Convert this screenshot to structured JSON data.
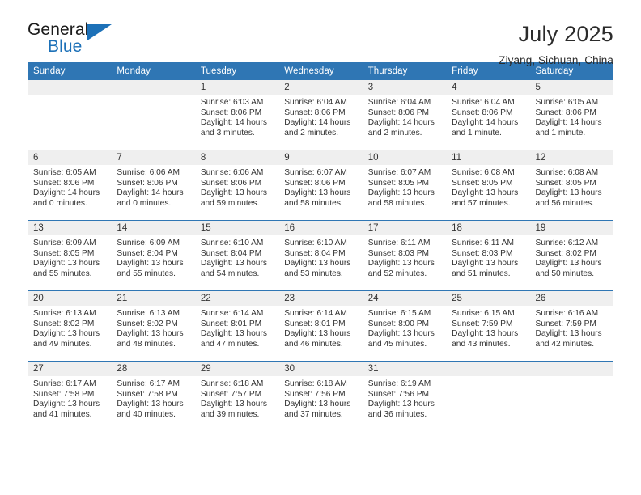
{
  "brand": {
    "name_top": "General",
    "name_bottom": "Blue",
    "accent_color": "#1d71b8"
  },
  "header": {
    "title": "July 2025",
    "location": "Ziyang, Sichuan, China"
  },
  "theme": {
    "header_blue": "#2f76b4",
    "daynum_gray": "#efefef",
    "text": "#333333"
  },
  "weekday_headers": [
    "Sunday",
    "Monday",
    "Tuesday",
    "Wednesday",
    "Thursday",
    "Friday",
    "Saturday"
  ],
  "labels": {
    "sunrise_prefix": "Sunrise:",
    "sunset_prefix": "Sunset:",
    "daylight_prefix": "Daylight:"
  },
  "weeks": [
    [
      {
        "day": "",
        "sunrise": "",
        "sunset": "",
        "daylight": ""
      },
      {
        "day": "",
        "sunrise": "",
        "sunset": "",
        "daylight": ""
      },
      {
        "day": "1",
        "sunrise": "Sunrise: 6:03 AM",
        "sunset": "Sunset: 8:06 PM",
        "daylight": "Daylight: 14 hours and 3 minutes."
      },
      {
        "day": "2",
        "sunrise": "Sunrise: 6:04 AM",
        "sunset": "Sunset: 8:06 PM",
        "daylight": "Daylight: 14 hours and 2 minutes."
      },
      {
        "day": "3",
        "sunrise": "Sunrise: 6:04 AM",
        "sunset": "Sunset: 8:06 PM",
        "daylight": "Daylight: 14 hours and 2 minutes."
      },
      {
        "day": "4",
        "sunrise": "Sunrise: 6:04 AM",
        "sunset": "Sunset: 8:06 PM",
        "daylight": "Daylight: 14 hours and 1 minute."
      },
      {
        "day": "5",
        "sunrise": "Sunrise: 6:05 AM",
        "sunset": "Sunset: 8:06 PM",
        "daylight": "Daylight: 14 hours and 1 minute."
      }
    ],
    [
      {
        "day": "6",
        "sunrise": "Sunrise: 6:05 AM",
        "sunset": "Sunset: 8:06 PM",
        "daylight": "Daylight: 14 hours and 0 minutes."
      },
      {
        "day": "7",
        "sunrise": "Sunrise: 6:06 AM",
        "sunset": "Sunset: 8:06 PM",
        "daylight": "Daylight: 14 hours and 0 minutes."
      },
      {
        "day": "8",
        "sunrise": "Sunrise: 6:06 AM",
        "sunset": "Sunset: 8:06 PM",
        "daylight": "Daylight: 13 hours and 59 minutes."
      },
      {
        "day": "9",
        "sunrise": "Sunrise: 6:07 AM",
        "sunset": "Sunset: 8:06 PM",
        "daylight": "Daylight: 13 hours and 58 minutes."
      },
      {
        "day": "10",
        "sunrise": "Sunrise: 6:07 AM",
        "sunset": "Sunset: 8:05 PM",
        "daylight": "Daylight: 13 hours and 58 minutes."
      },
      {
        "day": "11",
        "sunrise": "Sunrise: 6:08 AM",
        "sunset": "Sunset: 8:05 PM",
        "daylight": "Daylight: 13 hours and 57 minutes."
      },
      {
        "day": "12",
        "sunrise": "Sunrise: 6:08 AM",
        "sunset": "Sunset: 8:05 PM",
        "daylight": "Daylight: 13 hours and 56 minutes."
      }
    ],
    [
      {
        "day": "13",
        "sunrise": "Sunrise: 6:09 AM",
        "sunset": "Sunset: 8:05 PM",
        "daylight": "Daylight: 13 hours and 55 minutes."
      },
      {
        "day": "14",
        "sunrise": "Sunrise: 6:09 AM",
        "sunset": "Sunset: 8:04 PM",
        "daylight": "Daylight: 13 hours and 55 minutes."
      },
      {
        "day": "15",
        "sunrise": "Sunrise: 6:10 AM",
        "sunset": "Sunset: 8:04 PM",
        "daylight": "Daylight: 13 hours and 54 minutes."
      },
      {
        "day": "16",
        "sunrise": "Sunrise: 6:10 AM",
        "sunset": "Sunset: 8:04 PM",
        "daylight": "Daylight: 13 hours and 53 minutes."
      },
      {
        "day": "17",
        "sunrise": "Sunrise: 6:11 AM",
        "sunset": "Sunset: 8:03 PM",
        "daylight": "Daylight: 13 hours and 52 minutes."
      },
      {
        "day": "18",
        "sunrise": "Sunrise: 6:11 AM",
        "sunset": "Sunset: 8:03 PM",
        "daylight": "Daylight: 13 hours and 51 minutes."
      },
      {
        "day": "19",
        "sunrise": "Sunrise: 6:12 AM",
        "sunset": "Sunset: 8:02 PM",
        "daylight": "Daylight: 13 hours and 50 minutes."
      }
    ],
    [
      {
        "day": "20",
        "sunrise": "Sunrise: 6:13 AM",
        "sunset": "Sunset: 8:02 PM",
        "daylight": "Daylight: 13 hours and 49 minutes."
      },
      {
        "day": "21",
        "sunrise": "Sunrise: 6:13 AM",
        "sunset": "Sunset: 8:02 PM",
        "daylight": "Daylight: 13 hours and 48 minutes."
      },
      {
        "day": "22",
        "sunrise": "Sunrise: 6:14 AM",
        "sunset": "Sunset: 8:01 PM",
        "daylight": "Daylight: 13 hours and 47 minutes."
      },
      {
        "day": "23",
        "sunrise": "Sunrise: 6:14 AM",
        "sunset": "Sunset: 8:01 PM",
        "daylight": "Daylight: 13 hours and 46 minutes."
      },
      {
        "day": "24",
        "sunrise": "Sunrise: 6:15 AM",
        "sunset": "Sunset: 8:00 PM",
        "daylight": "Daylight: 13 hours and 45 minutes."
      },
      {
        "day": "25",
        "sunrise": "Sunrise: 6:15 AM",
        "sunset": "Sunset: 7:59 PM",
        "daylight": "Daylight: 13 hours and 43 minutes."
      },
      {
        "day": "26",
        "sunrise": "Sunrise: 6:16 AM",
        "sunset": "Sunset: 7:59 PM",
        "daylight": "Daylight: 13 hours and 42 minutes."
      }
    ],
    [
      {
        "day": "27",
        "sunrise": "Sunrise: 6:17 AM",
        "sunset": "Sunset: 7:58 PM",
        "daylight": "Daylight: 13 hours and 41 minutes."
      },
      {
        "day": "28",
        "sunrise": "Sunrise: 6:17 AM",
        "sunset": "Sunset: 7:58 PM",
        "daylight": "Daylight: 13 hours and 40 minutes."
      },
      {
        "day": "29",
        "sunrise": "Sunrise: 6:18 AM",
        "sunset": "Sunset: 7:57 PM",
        "daylight": "Daylight: 13 hours and 39 minutes."
      },
      {
        "day": "30",
        "sunrise": "Sunrise: 6:18 AM",
        "sunset": "Sunset: 7:56 PM",
        "daylight": "Daylight: 13 hours and 37 minutes."
      },
      {
        "day": "31",
        "sunrise": "Sunrise: 6:19 AM",
        "sunset": "Sunset: 7:56 PM",
        "daylight": "Daylight: 13 hours and 36 minutes."
      },
      {
        "day": "",
        "sunrise": "",
        "sunset": "",
        "daylight": ""
      },
      {
        "day": "",
        "sunrise": "",
        "sunset": "",
        "daylight": ""
      }
    ]
  ]
}
